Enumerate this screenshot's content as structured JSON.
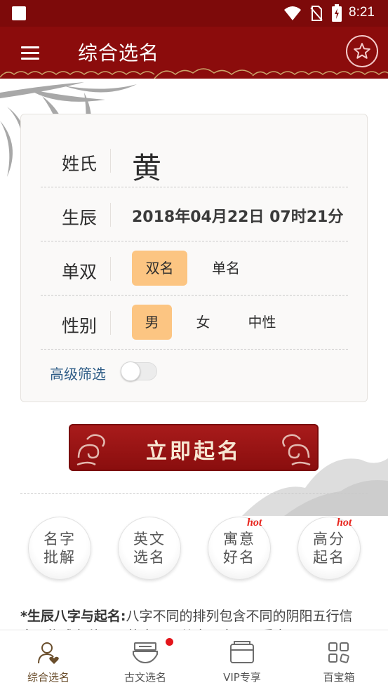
{
  "status_bar": {
    "time": "8:21"
  },
  "app_bar": {
    "title": "综合选名",
    "menu_icon": "hamburger-menu-icon",
    "favorite_icon": "star-icon"
  },
  "form": {
    "surname": {
      "label": "姓氏",
      "value": "黄"
    },
    "birth": {
      "label": "生辰",
      "value": "2018年04月22日 07时21分"
    },
    "name_length": {
      "label": "单双",
      "options": [
        "双名",
        "单名"
      ],
      "selected": "双名"
    },
    "gender": {
      "label": "性别",
      "options": [
        "男",
        "女",
        "中性"
      ],
      "selected": "男"
    },
    "advanced_filter": {
      "label": "高级筛选",
      "enabled": false
    }
  },
  "cta": {
    "label": "立即起名"
  },
  "features": [
    {
      "line1": "名字",
      "line2": "批解",
      "hot": ""
    },
    {
      "line1": "英文",
      "line2": "选名",
      "hot": ""
    },
    {
      "line1": "寓意",
      "line2": "好名",
      "hot": "hot"
    },
    {
      "line1": "高分",
      "line2": "起名",
      "hot": "hot"
    }
  ],
  "description": {
    "heading": "*生辰八字与起名:",
    "text": "八字不同的排列包含不同的阴阳五行信息，构成各种不同的命局，从命局中可以看出"
  },
  "bottom_nav": [
    {
      "label": "综合选名",
      "icon": "person-heart-icon",
      "active": true
    },
    {
      "label": "古文选名",
      "icon": "book-icon",
      "active": false,
      "badge": true
    },
    {
      "label": "VIP专享",
      "icon": "wallet-icon",
      "active": false
    },
    {
      "label": "百宝箱",
      "icon": "grid-apps-icon",
      "active": false
    }
  ],
  "colors": {
    "primary": "#8b0c0c",
    "accent": "#fcc582",
    "link": "#2f5d87"
  }
}
